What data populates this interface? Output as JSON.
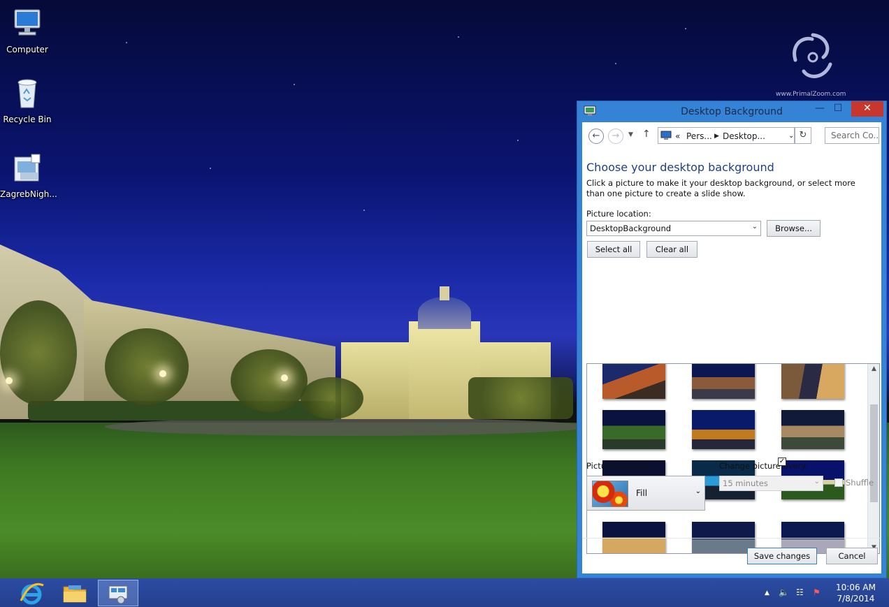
{
  "desktop": {
    "icons": [
      {
        "label": "Computer",
        "icon": "computer-icon"
      },
      {
        "label": "Recycle Bin",
        "icon": "recycle-bin-icon"
      },
      {
        "label": "ZagrebNigh...",
        "icon": "theme-pack-icon"
      }
    ],
    "watermark": "www.PrimalZoom.com"
  },
  "window": {
    "title": "Desktop Background",
    "controls": {
      "minimize": "—",
      "maximize": "☐",
      "close": "✕"
    },
    "address": {
      "prefix": "«",
      "crumbs": [
        "Pers...",
        "Desktop..."
      ],
      "search_placeholder": "Search Co..."
    },
    "heading": "Choose your desktop background",
    "description": "Click a picture to make it your desktop background, or select more than one picture to create a slide show.",
    "picture_location_label": "Picture location:",
    "picture_location_value": "DesktopBackground",
    "browse_label": "Browse...",
    "select_all_label": "Select all",
    "clear_all_label": "Clear all",
    "selected_index": 8,
    "picture_position_label": "Picture position:",
    "picture_position_value": "Fill",
    "change_every_label": "Change picture every:",
    "change_every_value": "15 minutes",
    "shuffle_label": "Shuffle",
    "shuffle_checked": false,
    "save_label": "Save changes",
    "cancel_label": "Cancel"
  },
  "taskbar": {
    "apps": [
      {
        "name": "internet-explorer",
        "active": false
      },
      {
        "name": "file-explorer",
        "active": false
      },
      {
        "name": "control-panel",
        "active": true
      }
    ],
    "time": "10:06 AM",
    "date": "7/8/2014"
  },
  "colors": {
    "window_frame": "#3583d6",
    "close_button": "#c7372e",
    "heading_text": "#1e3f8a",
    "taskbar": "#2d4da3"
  }
}
